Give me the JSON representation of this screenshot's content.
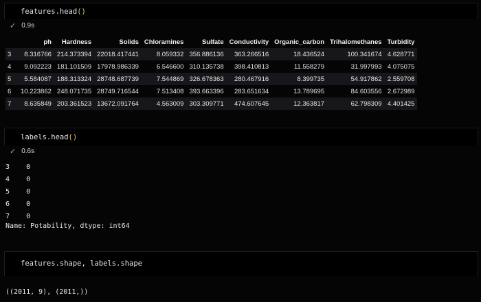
{
  "cells": [
    {
      "code": "features.head",
      "paren": "()",
      "time": "0.9s",
      "table": {
        "columns": [
          "",
          "ph",
          "Hardness",
          "Solids",
          "Chloramines",
          "Sulfate",
          "Conductivity",
          "Organic_carbon",
          "Trihalomethanes",
          "Turbidity"
        ],
        "rows": [
          [
            "3",
            "8.316766",
            "214.373394",
            "22018.417441",
            "8.059332",
            "356.886136",
            "363.266516",
            "18.436524",
            "100.341674",
            "4.628771"
          ],
          [
            "4",
            "9.092223",
            "181.101509",
            "17978.986339",
            "6.546600",
            "310.135738",
            "398.410813",
            "11.558279",
            "31.997993",
            "4.075075"
          ],
          [
            "5",
            "5.584087",
            "188.313324",
            "28748.687739",
            "7.544869",
            "326.678363",
            "280.467916",
            "8.399735",
            "54.917862",
            "2.559708"
          ],
          [
            "6",
            "10.223862",
            "248.071735",
            "28749.716544",
            "7.513408",
            "393.663396",
            "283.651634",
            "13.789695",
            "84.603556",
            "2.672989"
          ],
          [
            "7",
            "8.635849",
            "203.361523",
            "13672.091764",
            "4.563009",
            "303.309771",
            "474.607645",
            "12.363817",
            "62.798309",
            "4.401425"
          ]
        ]
      }
    },
    {
      "code": "labels.head",
      "paren": "()",
      "time": "0.6s",
      "output": [
        "3    0",
        "4    0",
        "5    0",
        "6    0",
        "7    0",
        "Name: Potability, dtype: int64"
      ]
    },
    {
      "code": "features.shape, labels.shape",
      "output": [
        "((2011, 9), (2011,))"
      ]
    }
  ],
  "icons": {
    "check": "check-icon"
  },
  "colors": {
    "background": "#050505",
    "paren": "#e5c06a",
    "check": "#7fbf63"
  }
}
